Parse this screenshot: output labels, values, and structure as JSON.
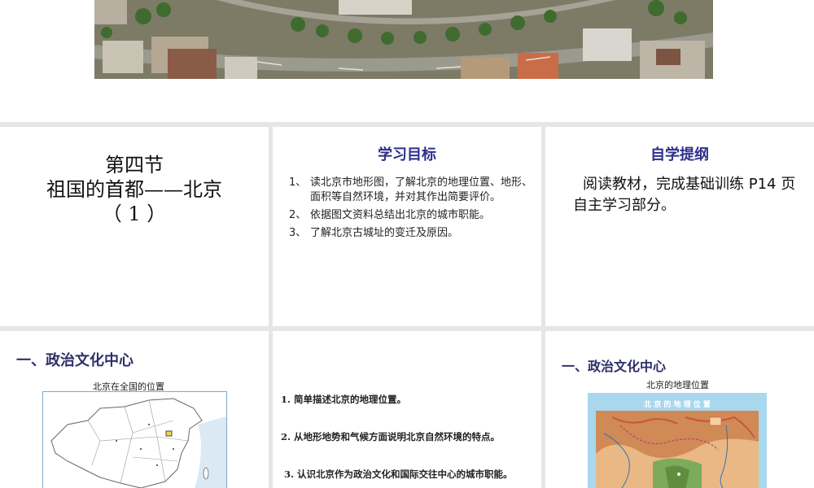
{
  "slide1": {
    "line1": "第四节",
    "line2": "祖国的首都——北京",
    "line3": "（ 1 ）"
  },
  "slide2": {
    "heading": "学习目标",
    "goals": [
      {
        "num": "1、",
        "text": "读北京市地形图，了解北京的地理位置、地形、面积等自然环境，并对其作出简要评价。"
      },
      {
        "num": "2、",
        "text": "依据图文资料总结出北京的城市职能。"
      },
      {
        "num": "3、",
        "text": "了解北京古城址的变迁及原因。"
      }
    ]
  },
  "slide3": {
    "heading": "自学提纲",
    "body": "阅读教材，完成基础训练 P14 页自主学习部分。"
  },
  "slide4": {
    "heading": "一、政治文化中心",
    "map_caption": "北京在全国的位置"
  },
  "slide5": {
    "questions": [
      "1. 简单描述北京的地理位置。",
      "2. 从地形地势和气候方面说明北京自然环境的特点。",
      "3. 认识北京作为政治文化和国际交往中心的城市职能。"
    ]
  },
  "slide6": {
    "heading": "一、政治文化中心",
    "map_caption": "北京的地理位置",
    "map_title": "北 京 的 地 理 位 置"
  },
  "colors": {
    "heading_blue": "#2f2f8a",
    "slide_bg": "#ffffff",
    "gap_gray": "#e6e6e6"
  }
}
